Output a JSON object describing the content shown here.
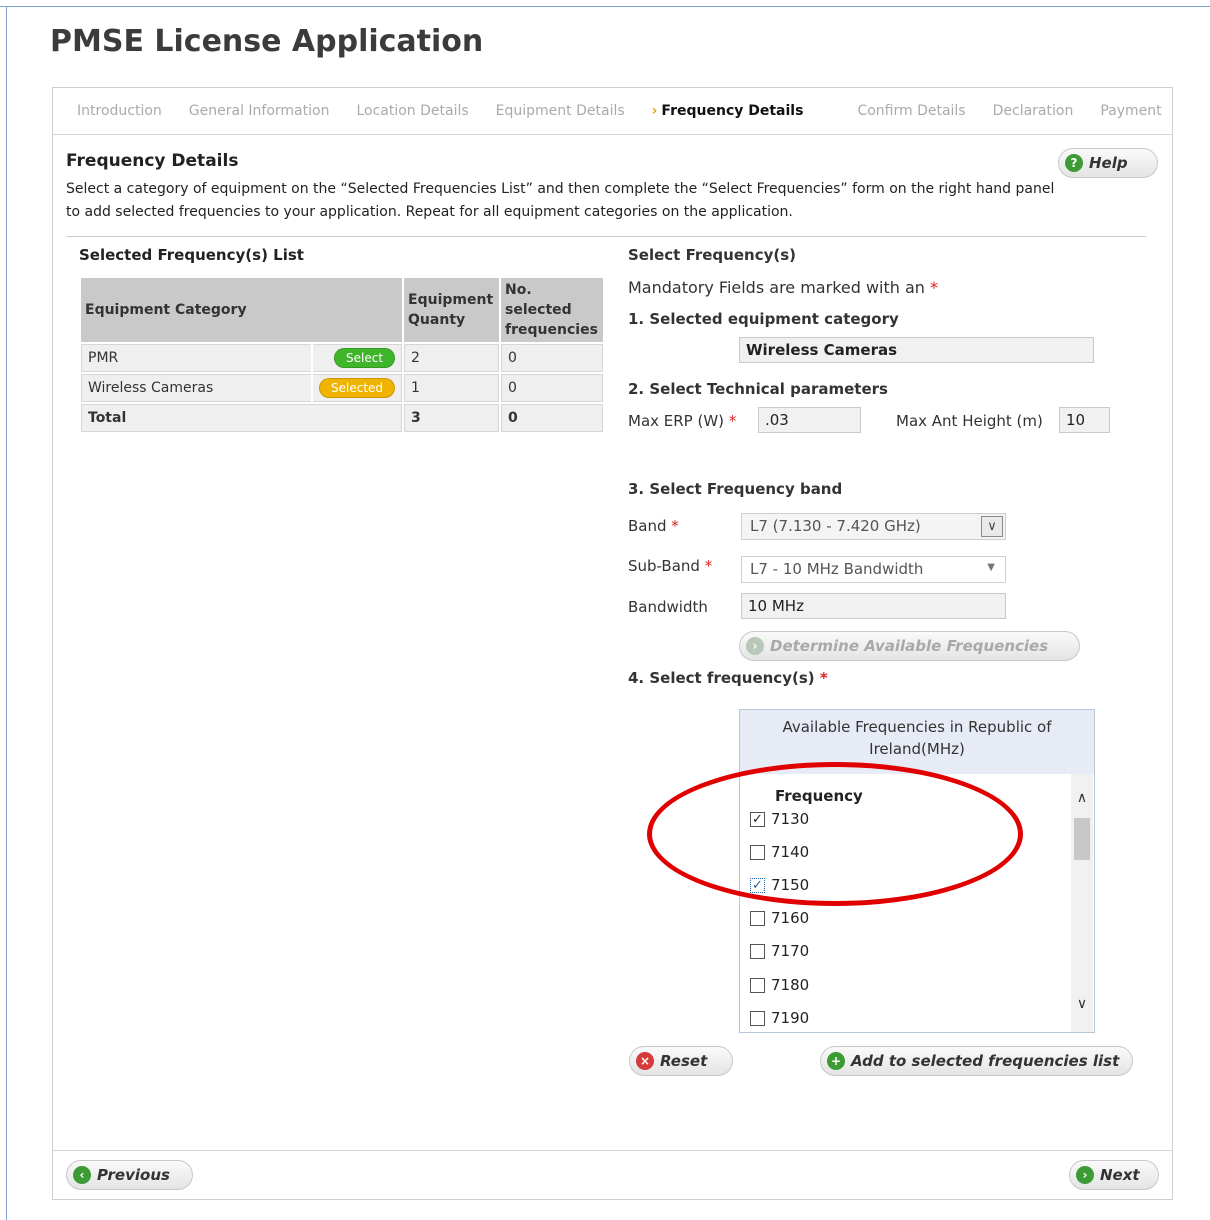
{
  "page": {
    "title": "PMSE License Application"
  },
  "wizard": {
    "steps": [
      "Introduction",
      "General Information",
      "Location Details",
      "Equipment Details",
      "Frequency Details",
      "Confirm Details",
      "Declaration",
      "Payment"
    ],
    "active_index": 4
  },
  "section": {
    "title": "Frequency Details",
    "intro": "Select a category of equipment on the “Selected Frequencies List” and then complete the “Select Frequencies” form on the right hand panel to add selected frequencies to your application. Repeat for all equipment categories on the application.",
    "help_label": "Help"
  },
  "selected_list": {
    "title": "Selected Frequency(s) List",
    "headers": [
      "Equipment Category",
      "Equipment Quanty",
      "No. selected frequencies"
    ],
    "rows": [
      {
        "category": "PMR",
        "button": "Select",
        "button_color": "#3fb52a",
        "quantity": "2",
        "selected": "0"
      },
      {
        "category": "Wireless Cameras",
        "button": "Selected",
        "button_color": "#f0b400",
        "quantity": "1",
        "selected": "0"
      }
    ],
    "total": {
      "label": "Total",
      "quantity": "3",
      "selected": "0"
    }
  },
  "select_form": {
    "title": "Select Frequency(s)",
    "mandatory_note": "Mandatory Fields are marked with an",
    "required_mark": "*",
    "step1_label": "1. Selected equipment category",
    "step1_value": "Wireless Cameras",
    "step2_label": "2. Select Technical parameters",
    "max_erp_label": "Max ERP (W)",
    "max_erp_value": ".03",
    "max_ant_label": "Max Ant Height (m)",
    "max_ant_value": "10",
    "step3_label": "3. Select Frequency band",
    "band_label": "Band",
    "band_value": "L7 (7.130 - 7.420 GHz)",
    "subband_label": "Sub-Band",
    "subband_value": "L7 - 10 MHz Bandwidth",
    "bandwidth_label": "Bandwidth",
    "bandwidth_value": "10 MHz",
    "determine_label": "Determine Available Frequencies",
    "step4_label": "4. Select frequency(s)",
    "freq_box_header": "Available Frequencies in Republic of Ireland(MHz)",
    "freq_col_title": "Frequency",
    "frequencies": [
      {
        "value": "7130",
        "checked": true
      },
      {
        "value": "7140",
        "checked": false
      },
      {
        "value": "7150",
        "checked": true
      },
      {
        "value": "7160",
        "checked": false
      },
      {
        "value": "7170",
        "checked": false
      },
      {
        "value": "7180",
        "checked": false
      },
      {
        "value": "7190",
        "checked": false
      }
    ],
    "reset_label": "Reset",
    "add_label": "Add to selected frequencies list"
  },
  "nav": {
    "previous_label": "Previous",
    "next_label": "Next"
  },
  "colors": {
    "accent_red": "#e00000",
    "header_gray": "#c9c9c9",
    "freq_header": "#e6ebf5"
  }
}
